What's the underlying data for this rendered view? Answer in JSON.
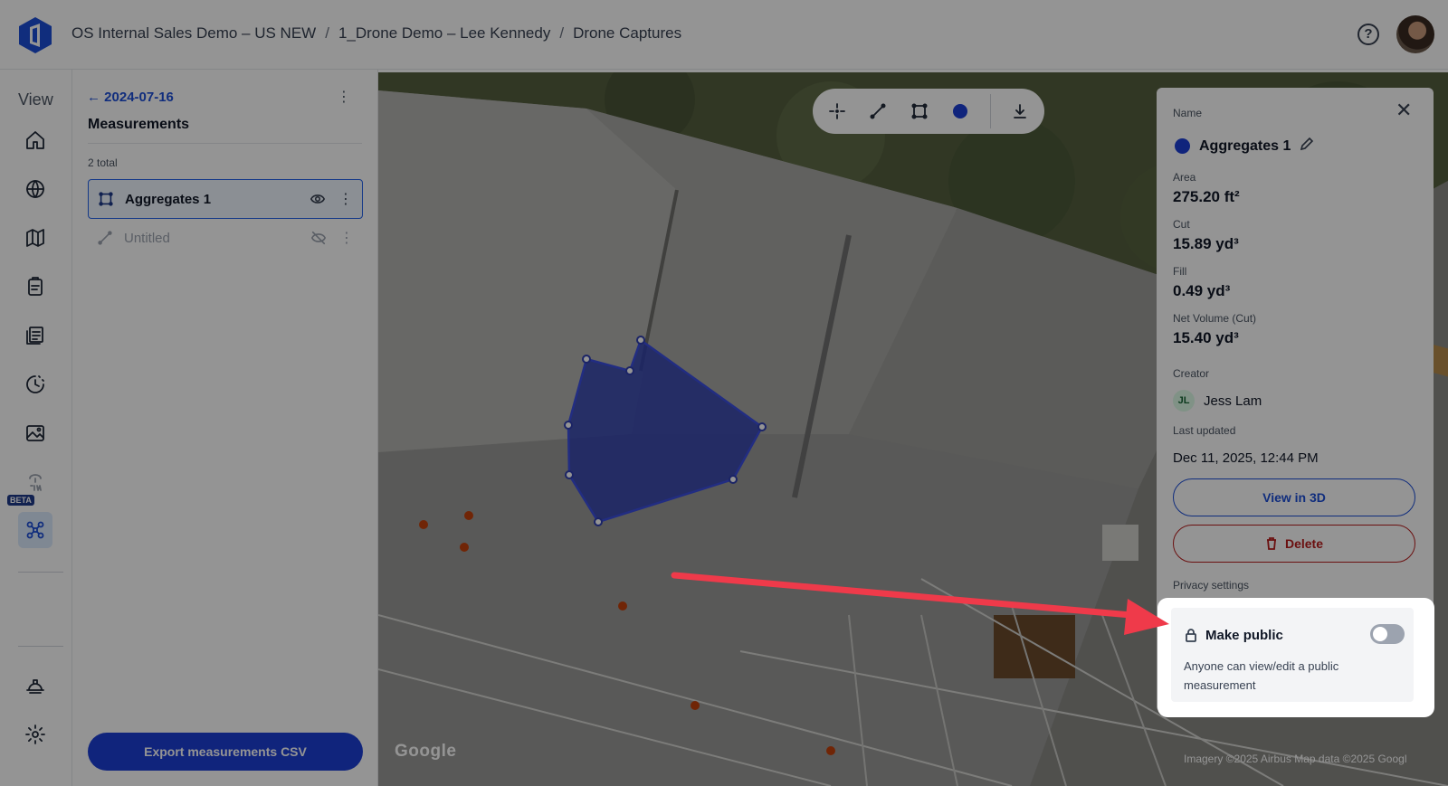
{
  "breadcrumb": [
    "OS Internal Sales Demo – US NEW",
    "1_Drone Demo – Lee Kennedy",
    "Drone Captures"
  ],
  "breadcrumb_sep": "/",
  "help_label": "?",
  "rail": {
    "title": "View",
    "items": [
      "home-icon",
      "globe-icon",
      "map-icon",
      "clipboard-icon",
      "reports-icon",
      "timeline-icon",
      "image-icon",
      "bim-icon",
      "drone-icon"
    ],
    "beta_label": "BETA",
    "bottom_items": [
      "hardhat-icon",
      "gear-icon"
    ]
  },
  "panel": {
    "back_label": "← 2024-07-16",
    "more_label": "⋮",
    "title": "Measurements",
    "total": "2 total",
    "rows": [
      {
        "label": "Aggregates 1",
        "visible": true,
        "selected": true
      },
      {
        "label": "Untitled",
        "visible": false,
        "selected": false
      }
    ],
    "row_more": "⋮",
    "export_label": "Export measurements CSV"
  },
  "map": {
    "google_label": "Google",
    "attribution": "Imagery ©2025 Airbus Map data ©2025 Googl",
    "toolbar": [
      "crosshair-icon",
      "line-icon",
      "polygon-icon",
      "color-dot-icon",
      "download-icon"
    ]
  },
  "details": {
    "name_label": "Name",
    "name": "Aggregates 1",
    "close": "✕",
    "area_label": "Area",
    "area": "275.20 ft²",
    "cut_label": "Cut",
    "cut": "15.89 yd³",
    "fill_label": "Fill",
    "fill": "0.49 yd³",
    "net_label": "Net Volume (Cut)",
    "net": "15.40 yd³",
    "creator_label": "Creator",
    "creator_initials": "JL",
    "creator_name": "Jess Lam",
    "updated_label": "Last updated",
    "updated": "Dec 11, 2025, 12:44 PM",
    "view3d_label": "View in 3D",
    "delete_label": "Delete",
    "privacy_label": "Privacy settings",
    "public_title": "Make public",
    "public_desc": "Anyone can view/edit a public measurement",
    "public_on": false
  },
  "colors": {
    "accent": "#1d3fd6",
    "danger": "#b91c1c",
    "polygon_fill": "#2f3fb0",
    "arrow": "#ef3a4a"
  }
}
